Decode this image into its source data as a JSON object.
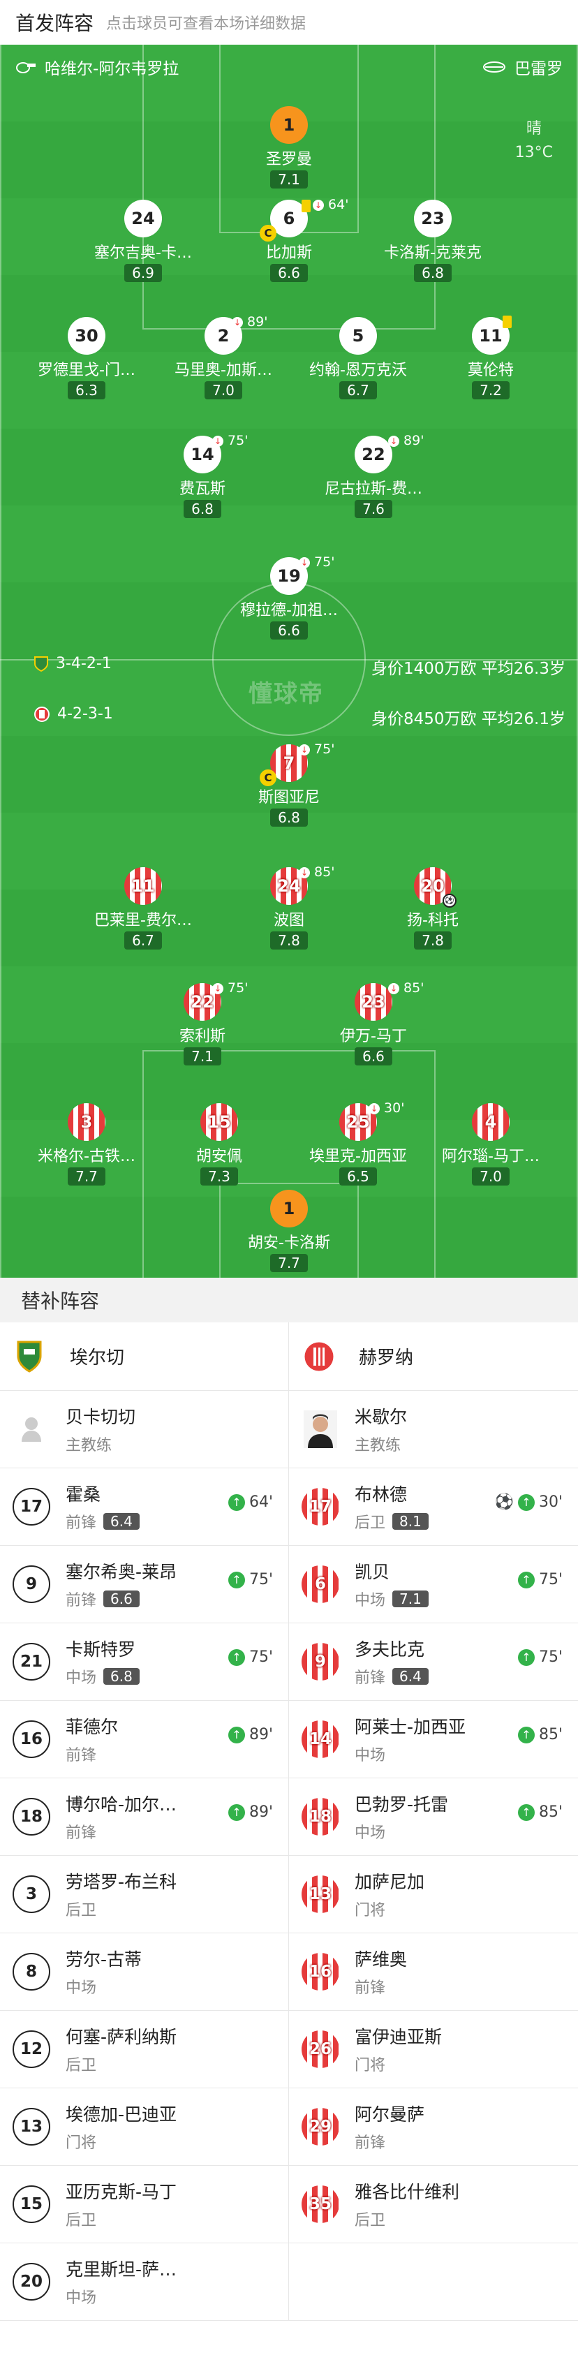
{
  "header": {
    "title": "首发阵容",
    "subtitle": "点击球员可查看本场详细数据"
  },
  "pitch": {
    "home_team": "哈维尔-阿尔韦罗拉",
    "away_team": "巴雷罗",
    "weather": {
      "condition": "晴",
      "temperature": "13°C"
    },
    "watermark": "懂球帝",
    "home_formation": "3-4-2-1",
    "away_formation": "4-2-3-1",
    "home_value": "身价1400万欧  平均26.3岁",
    "away_value": "身价8450万欧  平均26.1岁",
    "home_players": [
      {
        "number": "1",
        "name": "圣罗曼",
        "rating": "7.1"
      },
      {
        "number": "6",
        "name": "比加斯",
        "rating": "6.6",
        "event": "64'"
      },
      {
        "number": "24",
        "name": "塞尔吉奥-卡…",
        "rating": "6.9"
      },
      {
        "number": "23",
        "name": "卡洛斯-克莱克",
        "rating": "6.8"
      },
      {
        "number": "30",
        "name": "罗德里戈-门…",
        "rating": "6.3"
      },
      {
        "number": "2",
        "name": "马里奥-加斯…",
        "rating": "7.0",
        "event": "89'"
      },
      {
        "number": "5",
        "name": "约翰-恩万克沃",
        "rating": "6.7"
      },
      {
        "number": "11",
        "name": "莫伦特",
        "rating": "7.2"
      },
      {
        "number": "14",
        "name": "费瓦斯",
        "rating": "6.8",
        "event": "75'"
      },
      {
        "number": "22",
        "name": "尼古拉斯-费…",
        "rating": "7.6",
        "event": "89'"
      },
      {
        "number": "19",
        "name": "穆拉德-加祖…",
        "rating": "6.6",
        "event": "75'"
      }
    ],
    "away_players": [
      {
        "number": "7",
        "name": "斯图亚尼",
        "rating": "6.8",
        "event": "75'"
      },
      {
        "number": "11",
        "name": "巴莱里-费尔…",
        "rating": "6.7"
      },
      {
        "number": "24",
        "name": "波图",
        "rating": "7.8",
        "event": "85'"
      },
      {
        "number": "20",
        "name": "扬-科托",
        "rating": "7.8"
      },
      {
        "number": "22",
        "name": "索利斯",
        "rating": "7.1",
        "event": "75'"
      },
      {
        "number": "23",
        "name": "伊万-马丁",
        "rating": "6.6",
        "event": "85'"
      },
      {
        "number": "3",
        "name": "米格尔-古铁…",
        "rating": "7.7"
      },
      {
        "number": "15",
        "name": "胡安佩",
        "rating": "7.3"
      },
      {
        "number": "25",
        "name": "埃里克-加西亚",
        "rating": "6.5",
        "event": "30'"
      },
      {
        "number": "4",
        "name": "阿尔瑙-马丁…",
        "rating": "7.0"
      },
      {
        "number": "1",
        "name": "胡安-卡洛斯",
        "rating": "7.7"
      }
    ]
  },
  "bench": {
    "title": "替补阵容",
    "home_team": "埃尔切",
    "away_team": "赫罗纳",
    "home_coach": {
      "name": "贝卡切切",
      "role": "主教练"
    },
    "away_coach": {
      "name": "米歇尔",
      "role": "主教练"
    },
    "rows": [
      {
        "home": {
          "number": "17",
          "name": "霍桑",
          "pos": "前锋",
          "rating": "6.4",
          "event": "64'"
        },
        "away": {
          "number": "17",
          "name": "布林德",
          "pos": "后卫",
          "rating": "8.1",
          "event": "30'",
          "goal": true
        }
      },
      {
        "home": {
          "number": "9",
          "name": "塞尔希奥-莱昂",
          "pos": "前锋",
          "rating": "6.6",
          "event": "75'"
        },
        "away": {
          "number": "6",
          "name": "凯贝",
          "pos": "中场",
          "rating": "7.1",
          "event": "75'"
        }
      },
      {
        "home": {
          "number": "21",
          "name": "卡斯特罗",
          "pos": "中场",
          "rating": "6.8",
          "event": "75'"
        },
        "away": {
          "number": "9",
          "name": "多夫比克",
          "pos": "前锋",
          "rating": "6.4",
          "event": "75'"
        }
      },
      {
        "home": {
          "number": "16",
          "name": "菲德尔",
          "pos": "前锋",
          "rating": "",
          "event": "89'"
        },
        "away": {
          "number": "14",
          "name": "阿莱士-加西亚",
          "pos": "中场",
          "rating": "",
          "event": "85'"
        }
      },
      {
        "home": {
          "number": "18",
          "name": "博尔哈-加尔…",
          "pos": "前锋",
          "rating": "",
          "event": "89'"
        },
        "away": {
          "number": "18",
          "name": "巴勃罗-托雷",
          "pos": "中场",
          "rating": "",
          "event": "85'"
        }
      },
      {
        "home": {
          "number": "3",
          "name": "劳塔罗-布兰科",
          "pos": "后卫",
          "rating": "",
          "event": ""
        },
        "away": {
          "number": "13",
          "name": "加萨尼加",
          "pos": "门将",
          "rating": "",
          "event": ""
        }
      },
      {
        "home": {
          "number": "8",
          "name": "劳尔-古蒂",
          "pos": "中场",
          "rating": "",
          "event": ""
        },
        "away": {
          "number": "16",
          "name": "萨维奥",
          "pos": "前锋",
          "rating": "",
          "event": ""
        }
      },
      {
        "home": {
          "number": "12",
          "name": "何塞-萨利纳斯",
          "pos": "后卫",
          "rating": "",
          "event": ""
        },
        "away": {
          "number": "26",
          "name": "富伊迪亚斯",
          "pos": "门将",
          "rating": "",
          "event": ""
        }
      },
      {
        "home": {
          "number": "13",
          "name": "埃德加-巴迪亚",
          "pos": "门将",
          "rating": "",
          "event": ""
        },
        "away": {
          "number": "29",
          "name": "阿尔曼萨",
          "pos": "前锋",
          "rating": "",
          "event": ""
        }
      },
      {
        "home": {
          "number": "15",
          "name": "亚历克斯-马丁",
          "pos": "后卫",
          "rating": "",
          "event": ""
        },
        "away": {
          "number": "35",
          "name": "雅各比什维利",
          "pos": "后卫",
          "rating": "",
          "event": ""
        }
      },
      {
        "home": {
          "number": "20",
          "name": "克里斯坦-萨…",
          "pos": "中场",
          "rating": "",
          "event": ""
        },
        "away": null
      }
    ]
  },
  "colors": {
    "pitch": "#36a83f",
    "home_kit": "#ffffff",
    "home_gk": "#f7941d",
    "away_kit": "#e53b3b",
    "rating_bg": "#1e6b28",
    "sub_in": "#33b24a"
  }
}
